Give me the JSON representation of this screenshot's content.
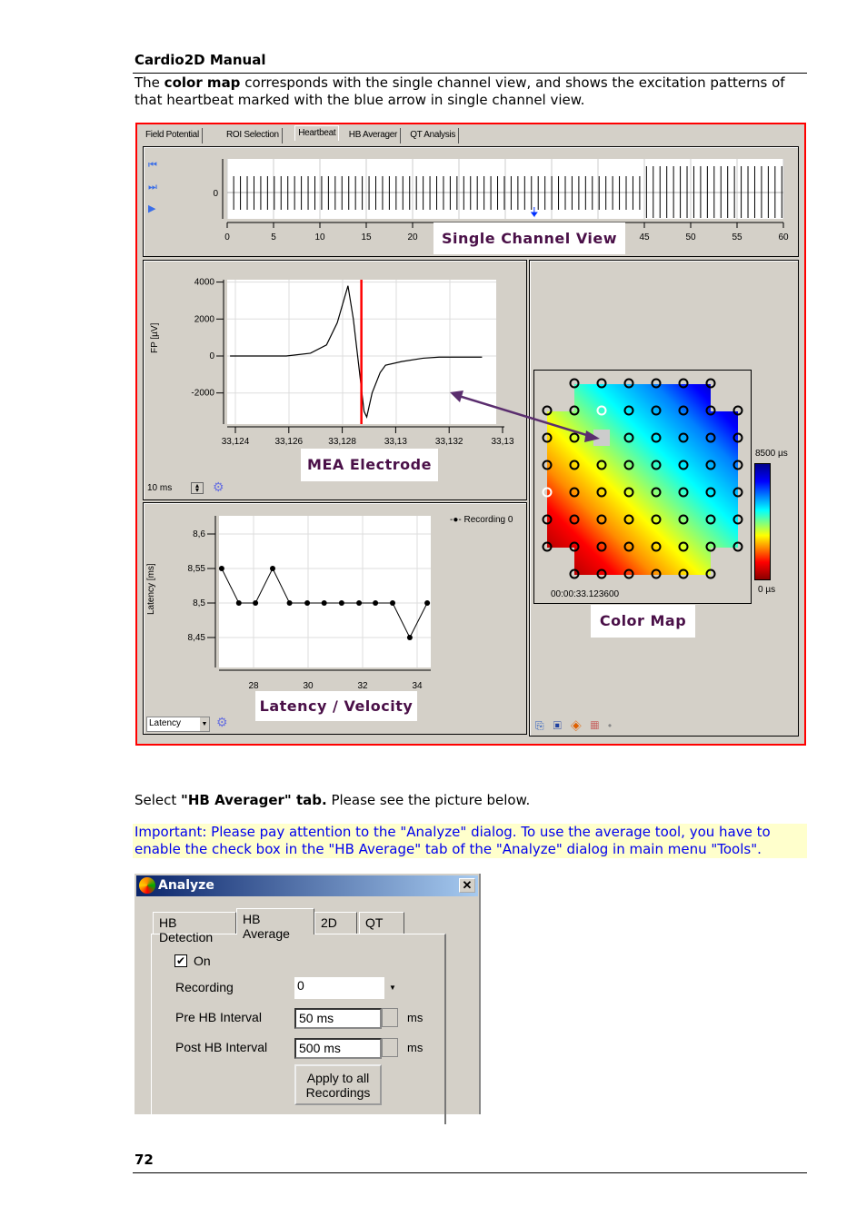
{
  "header": {
    "title": "Cardio2D Manual"
  },
  "intro": {
    "pre": "The ",
    "bold": "color map",
    "post": " corresponds with the single channel view, and shows the excitation patterns of that heartbeat marked with the blue arrow in single channel view."
  },
  "screenshot": {
    "tabs": [
      "Field Potential",
      "ROI Selection",
      "Heartbeat",
      "HB Averager",
      "QT Analysis"
    ],
    "active_tab": "Heartbeat",
    "nav_icons": [
      "first-icon",
      "next-icon",
      "play-icon"
    ],
    "labels": {
      "single_channel": "Single Channel View",
      "mea": "MEA Electrode",
      "latency": "Latency / Velocity",
      "colormap": "Color Map"
    },
    "fp_window": "10 ms",
    "latency_select": "Latency",
    "timestamp": "00:00:33.123600",
    "colorbar": {
      "max": "8500 µs",
      "min": "0 µs",
      "colors": [
        "#00008b",
        "#0000ff",
        "#00ffff",
        "#ffff00",
        "#ff0000",
        "#8b0000"
      ]
    },
    "arrow_color": "#5a2d6e",
    "marker_color": "#ff0000"
  },
  "chart_data": [
    {
      "type": "bar",
      "name": "single-channel",
      "xlim": [
        0,
        60
      ],
      "xticks": [
        "0",
        "5",
        "10",
        "15",
        "20",
        "25",
        "30",
        "35",
        "40",
        "45",
        "50",
        "55",
        "60"
      ],
      "yticks": [
        "0"
      ],
      "marked_beat": 33.12
    },
    {
      "type": "line",
      "ylabel": "FP [µV]",
      "xticks": [
        "33,124",
        "33,126",
        "33,128",
        "33,13",
        "33,132",
        "33,13"
      ],
      "yticks": [
        "4000",
        "2000",
        "0",
        "-2000"
      ],
      "xlim": [
        33.1237,
        33.1333
      ],
      "ylim": [
        -3700,
        4200
      ],
      "grid": true,
      "marker_x": 33.1287,
      "x": [
        33.1238,
        33.1259,
        33.1268,
        33.1274,
        33.1278,
        33.1281,
        33.1282,
        33.1284,
        33.1286,
        33.1288,
        33.1289,
        33.1291,
        33.1294,
        33.1296,
        33.1302,
        33.131,
        33.1316,
        33.1332
      ],
      "y": [
        0,
        0,
        150,
        600,
        1800,
        3300,
        3800,
        2000,
        -500,
        -3000,
        -3300,
        -2000,
        -900,
        -500,
        -300,
        -120,
        -60,
        -60
      ]
    },
    {
      "type": "line",
      "ylabel": "Latency [ms]",
      "legend": "Recording 0",
      "legend_placement": "top-right",
      "xticks": [
        "28",
        "30",
        "32",
        "34"
      ],
      "yticks": [
        "8,6",
        "8,55",
        "8,5",
        "8,45"
      ],
      "xlim": [
        26.8,
        34.5
      ],
      "ylim": [
        8.4,
        8.63
      ],
      "grid": true,
      "x": [
        26.83,
        27.46,
        28.07,
        28.7,
        29.32,
        29.97,
        30.59,
        31.23,
        31.87,
        32.47,
        33.1,
        33.73,
        34.37
      ],
      "y": [
        8.55,
        8.5,
        8.5,
        8.55,
        8.5,
        8.5,
        8.5,
        8.5,
        8.5,
        8.5,
        8.5,
        8.45,
        8.5
      ]
    }
  ],
  "instruction": {
    "pre": "Select ",
    "bold": "\"HB Averager\" tab.",
    "post": " Please see the picture below."
  },
  "note": "Important: Please pay attention to the \"Analyze\" dialog. To use the average tool, you have to enable the check box in the \"HB Average\" tab of the \"Analyze\" dialog in main menu \"Tools\".",
  "dialog": {
    "title": "Analyze",
    "tabs": [
      "HB Detection",
      "HB Average",
      "2D",
      "QT"
    ],
    "active_tab": "HB Average",
    "on_label": "On",
    "on_checked": true,
    "recording_label": "Recording",
    "recording_value": "0",
    "pre_label": "Pre HB Interval",
    "pre_value": "50 ms",
    "pre_unit": "ms",
    "post_label": "Post HB Interval",
    "post_value": "500 ms",
    "post_unit": "ms",
    "apply_line1": "Apply to all",
    "apply_line2": "Recordings"
  },
  "footer": {
    "page": "72"
  }
}
